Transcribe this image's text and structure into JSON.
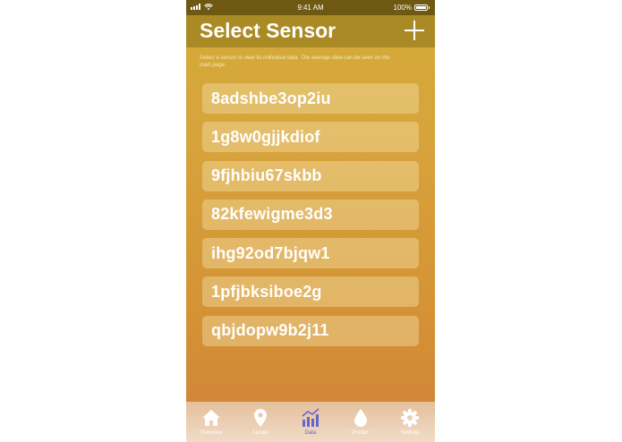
{
  "status_bar": {
    "time": "9:41 AM",
    "battery_text": "100%"
  },
  "header": {
    "title": "Select Sensor",
    "add_icon": "plus-icon"
  },
  "description": "Select a sensor to view its individual data. The average data can be seen on the main page.",
  "sensors": [
    "8adshbe3op2iu",
    "1g8w0gjjkdiof",
    "9fjhbiu67skbb",
    "82kfewigme3d3",
    "ihg92od7bjqw1",
    "1pfjbksiboe2g",
    "qbjdopw9b2j11"
  ],
  "tabs": [
    {
      "label": "Overview",
      "icon": "home-icon",
      "active": false
    },
    {
      "label": "Locals",
      "icon": "location-pin-icon",
      "active": false
    },
    {
      "label": "Data",
      "icon": "chart-icon",
      "active": true
    },
    {
      "label": "Predict",
      "icon": "drop-icon",
      "active": false
    },
    {
      "label": "Settings",
      "icon": "gear-icon",
      "active": false
    }
  ],
  "colors": {
    "header": "#a98a25",
    "status_bar": "#6e5812",
    "active_tab": "#6666cc"
  }
}
